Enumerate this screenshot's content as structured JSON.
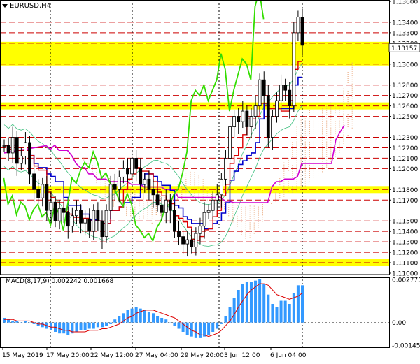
{
  "chart_data": {
    "type": "candlestick",
    "symbol": "EURUSD,H4",
    "current_price": "1.13157",
    "price_axis_labels": [
      "1.13600",
      "1.13400",
      "1.13300",
      "1.13200",
      "1.13000",
      "1.12800",
      "1.12700",
      "1.12600",
      "1.12500",
      "1.12300",
      "1.12200",
      "1.12100",
      "1.12000",
      "1.11800",
      "1.11700",
      "1.11500",
      "1.11400",
      "1.11300",
      "1.11200",
      "1.11100",
      "1.11000"
    ],
    "ylim": [
      1.11,
      1.136
    ],
    "time_labels": [
      "15 May 2019",
      "17 May 20:00",
      "22 May 12:00",
      "27 May 04:00",
      "29 May 20:00",
      "3 Jun 12:00",
      "6 Jun 04:00"
    ],
    "resistance_levels": [
      1.134,
      1.133,
      1.132,
      1.13,
      1.128,
      1.127,
      1.126,
      1.125,
      1.123,
      1.122,
      1.121,
      1.12,
      1.118,
      1.117,
      1.115,
      1.114,
      1.113,
      1.112,
      1.111
    ],
    "highlight_zones": [
      [
        1.13,
        1.132
      ],
      [
        1.1258,
        1.1262
      ],
      [
        1.1178,
        1.1182
      ],
      [
        1.1108,
        1.1112
      ]
    ],
    "candles_close": [
      1.1222,
      1.1215,
      1.123,
      1.1205,
      1.1212,
      1.1225,
      1.1195,
      1.118,
      1.1172,
      1.1185,
      1.116,
      1.1168,
      1.115,
      1.1162,
      1.1158,
      1.1145,
      1.1155,
      1.116,
      1.1148,
      1.1152,
      1.114,
      1.116,
      1.115,
      1.1135,
      1.116,
      1.1185,
      1.118,
      1.1192,
      1.12,
      1.1195,
      1.121,
      1.12,
      1.1185,
      1.119,
      1.118,
      1.1175,
      1.1165,
      1.1158,
      1.117,
      1.116,
      1.114,
      1.1135,
      1.1128,
      1.1132,
      1.1125,
      1.1138,
      1.1145,
      1.1158,
      1.116,
      1.117,
      1.1175,
      1.119,
      1.121,
      1.124,
      1.125,
      1.1245,
      1.1255,
      1.124,
      1.125,
      1.126,
      1.1285,
      1.127,
      1.123,
      1.125,
      1.1265,
      1.128,
      1.1275,
      1.126,
      1.133,
      1.1345,
      1.1318
    ],
    "macd_label": "MACD(8,17,9)",
    "macd_values": {
      "main": "0.002242",
      "signal": "0.001668"
    },
    "macd_axis_labels": [
      "0.002775",
      "0.00",
      "-0.001456"
    ],
    "macd_ylim": [
      -0.001456,
      0.002775
    ],
    "macd_histogram": [
      0.0003,
      0.0002,
      0.0001,
      0.0001,
      0.0,
      0.0001,
      0.0,
      -0.0001,
      -0.0002,
      -0.0003,
      -0.0004,
      -0.0005,
      -0.0006,
      -0.0007,
      -0.0007,
      -0.0008,
      -0.0007,
      -0.0006,
      -0.0005,
      -0.0005,
      -0.0004,
      -0.0004,
      -0.0003,
      -0.0003,
      -0.0002,
      -0.0001,
      0.0002,
      0.0004,
      0.0006,
      0.0008,
      0.0009,
      0.001,
      0.0009,
      0.0008,
      0.0007,
      0.0006,
      0.0004,
      0.0003,
      0.0002,
      0.0,
      -0.0002,
      -0.0004,
      -0.0006,
      -0.0008,
      -0.0009,
      -0.001,
      -0.001,
      -0.0009,
      -0.0008,
      -0.0006,
      -0.0004,
      -0.0001,
      0.0004,
      0.001,
      0.0016,
      0.0021,
      0.0025,
      0.0026,
      0.0026,
      0.0027,
      0.0028,
      0.0025,
      0.0018,
      0.0012,
      0.001,
      0.0014,
      0.0014,
      0.0012,
      0.0019,
      0.0024,
      0.0024
    ],
    "macd_signal_line": [
      0.0002,
      0.0002,
      0.0002,
      0.0001,
      0.0001,
      0.0001,
      0.0001,
      0.0,
      -0.0001,
      -0.0001,
      -0.0002,
      -0.0003,
      -0.0003,
      -0.0004,
      -0.0005,
      -0.0005,
      -0.0006,
      -0.0006,
      -0.0006,
      -0.0006,
      -0.0005,
      -0.0005,
      -0.0005,
      -0.0004,
      -0.0004,
      -0.0003,
      -0.0002,
      -0.0001,
      0.0001,
      0.0003,
      0.0004,
      0.0006,
      0.0007,
      0.0008,
      0.0008,
      0.0008,
      0.0007,
      0.0006,
      0.0005,
      0.0004,
      0.0003,
      0.0001,
      -0.0001,
      -0.0003,
      -0.0005,
      -0.0006,
      -0.0008,
      -0.0008,
      -0.0009,
      -0.0008,
      -0.0007,
      -0.0005,
      -0.0002,
      0.0001,
      0.0005,
      0.001,
      0.0014,
      0.0018,
      0.0021,
      0.0023,
      0.0025,
      0.0025,
      0.0024,
      0.0021,
      0.0018,
      0.0017,
      0.0016,
      0.0015,
      0.0016,
      0.0017,
      0.0019
    ]
  }
}
